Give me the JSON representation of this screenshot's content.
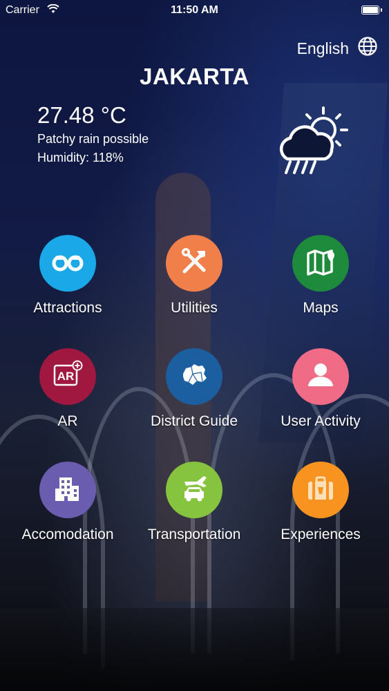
{
  "status_bar": {
    "carrier": "Carrier",
    "time": "11:50 AM"
  },
  "language": {
    "label": "English",
    "icon": "globe-icon"
  },
  "city": "JAKARTA",
  "weather": {
    "temperature": "27.48 °C",
    "condition": "Patchy rain possible",
    "humidity": "Humidity: 118%",
    "icon": "rain-sun-cloud-icon"
  },
  "menu": [
    {
      "label": "Attractions",
      "icon": "binoculars-icon",
      "color": "#1aa8e8"
    },
    {
      "label": "Utilities",
      "icon": "tools-icon",
      "color": "#f07f4a"
    },
    {
      "label": "Maps",
      "icon": "map-icon",
      "color": "#1d8a3c"
    },
    {
      "label": "AR",
      "icon": "ar-icon",
      "color": "#a0173f"
    },
    {
      "label": "District Guide",
      "icon": "district-map-icon",
      "color": "#1c5fa0"
    },
    {
      "label": "User Activity",
      "icon": "user-icon",
      "color": "#ef6b86"
    },
    {
      "label": "Accomodation",
      "icon": "building-icon",
      "color": "#6a5caf"
    },
    {
      "label": "Transportation",
      "icon": "transport-icon",
      "color": "#86c33e"
    },
    {
      "label": "Experiences",
      "icon": "suitcase-icon",
      "color": "#f7931e"
    }
  ]
}
